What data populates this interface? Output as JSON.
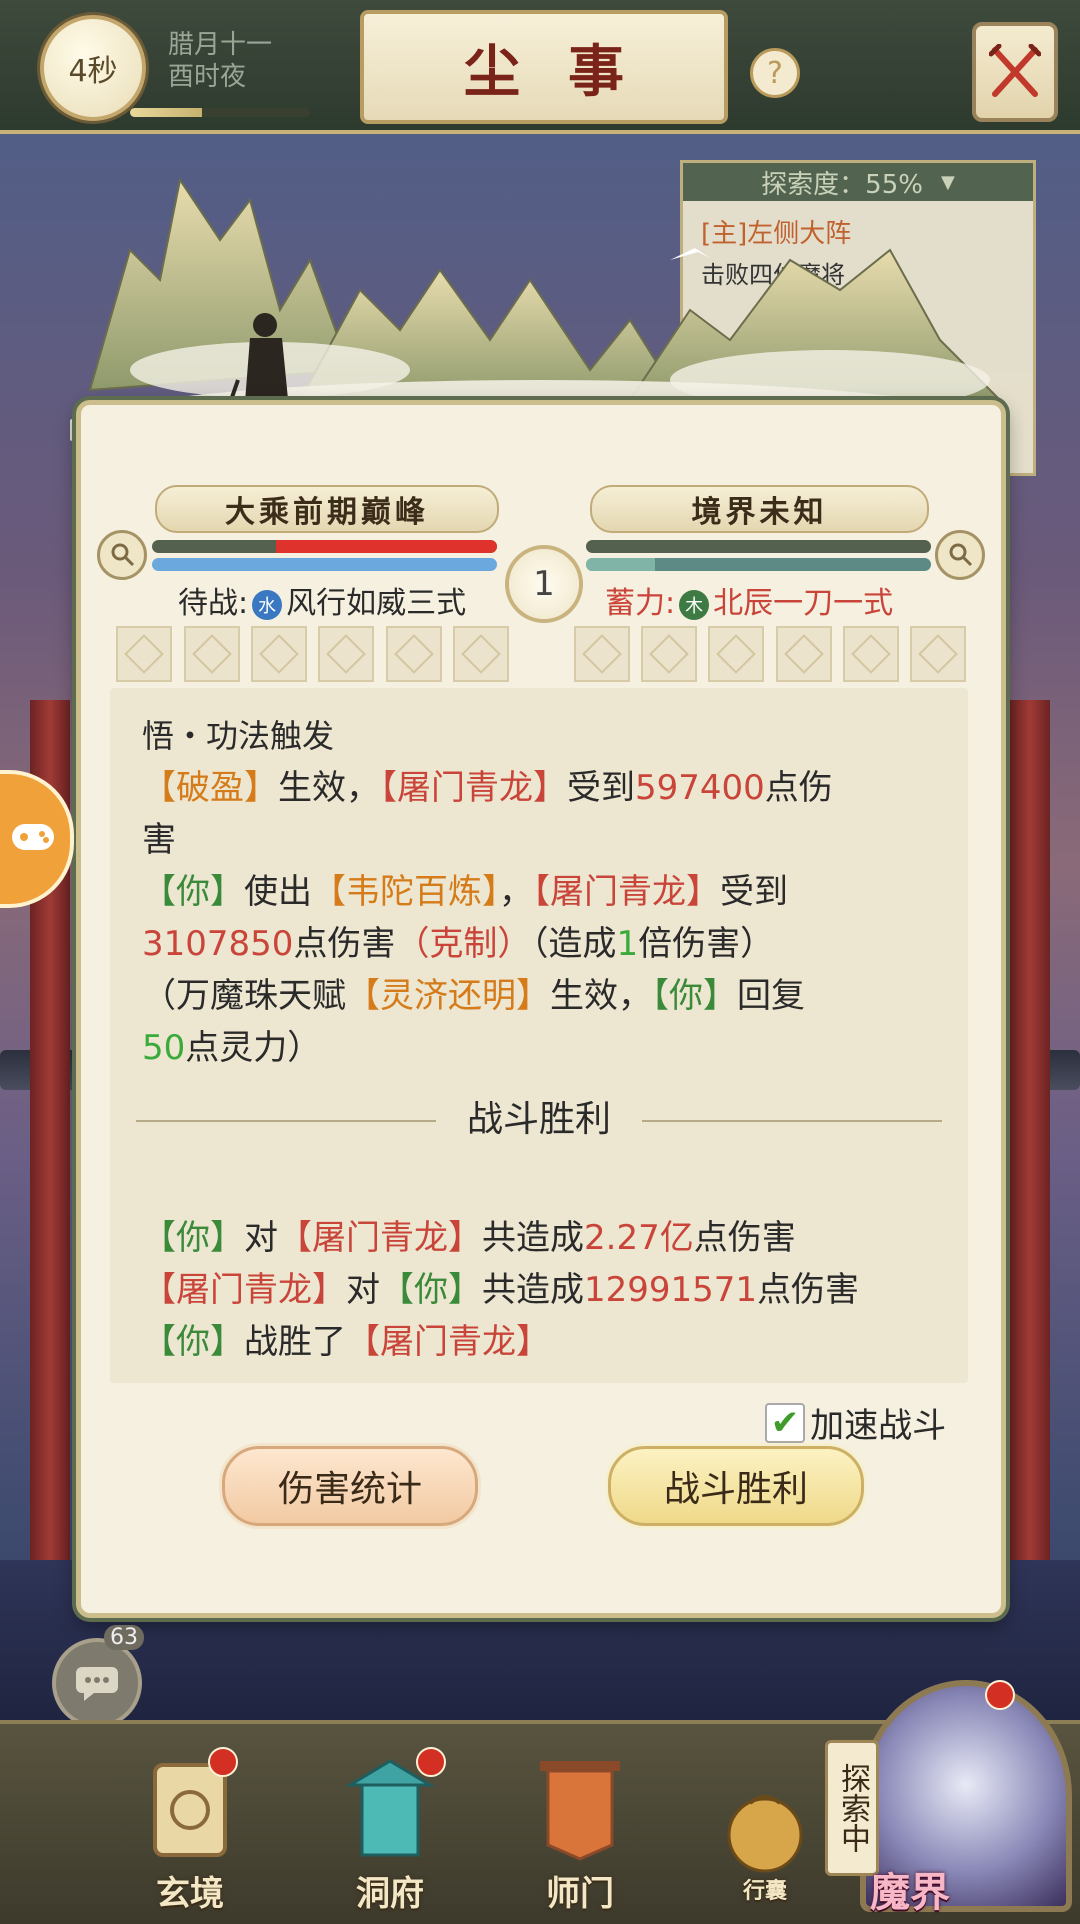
{
  "header": {
    "timer": "4秒",
    "date_line1": "腊月十一",
    "date_line2": "酉时夜",
    "title": "尘事",
    "help_icon": "question-mark-icon",
    "close_icon": "crossed-swords-icon"
  },
  "explore_panel": {
    "progress_label": "探索度：55%",
    "task": "[主]左侧大阵",
    "subtask": "击败四位魔将"
  },
  "battle": {
    "player": {
      "realm": "大乘前期巅峰",
      "hp_fraction": 0.64,
      "mp_fraction": 1.0,
      "status_prefix": "待战:",
      "element": "水",
      "skill": "风行如威三式"
    },
    "enemy": {
      "realm": "境界未知",
      "hp_fraction": 1.0,
      "mp_fraction": 0.2,
      "status_prefix": "蓄力:",
      "element": "木",
      "skill": "北辰一刀一式"
    },
    "round": "1"
  },
  "log": {
    "l1": "悟・功法触发",
    "l2": {
      "a": "【破盈】",
      "b": "生效，",
      "c": "【屠门青龙】",
      "d": "受到",
      "e": "597400",
      "f": "点伤"
    },
    "l3": "害",
    "l4": {
      "a": "【你】",
      "b": "使出",
      "c": "【韦陀百炼】",
      "d": "，",
      "e": "【屠门青龙】",
      "f": "受到"
    },
    "l5": {
      "a": "3107850",
      "b": "点伤害",
      "c": "（克制）",
      "d": "（造成",
      "e": "1",
      "f": "倍伤害）"
    },
    "l6": {
      "a": "（万魔珠天赋",
      "b": "【灵济还明】",
      "c": "生效，",
      "d": "【你】",
      "e": "回复"
    },
    "l7": {
      "a": "50",
      "b": "点灵力）"
    },
    "divider": "战斗胜利",
    "s1": {
      "a": "【你】",
      "b": "对",
      "c": "【屠门青龙】",
      "d": "共造成",
      "e": "2.27亿",
      "f": "点伤害"
    },
    "s2": {
      "a": "【屠门青龙】",
      "b": "对",
      "c": "【你】",
      "d": "共造成",
      "e": "12991571",
      "f": "点伤害"
    },
    "s3": {
      "a": "【你】",
      "b": "战胜了",
      "c": "【屠门青龙】"
    }
  },
  "controls": {
    "accelerate_label": "加速战斗",
    "accelerate_checked": true,
    "stats_button": "伤害统计",
    "victory_button": "战斗胜利"
  },
  "chat": {
    "count": "63"
  },
  "nav": {
    "items": [
      {
        "label": "玄境"
      },
      {
        "label": "洞府"
      },
      {
        "label": "师门"
      },
      {
        "label": "行囊"
      }
    ],
    "explore_badge": "探索中",
    "mojie": "魔界"
  },
  "colors": {
    "accent_red": "#c9453a",
    "accent_orange": "#d57b19",
    "accent_green": "#3a8a3a"
  }
}
